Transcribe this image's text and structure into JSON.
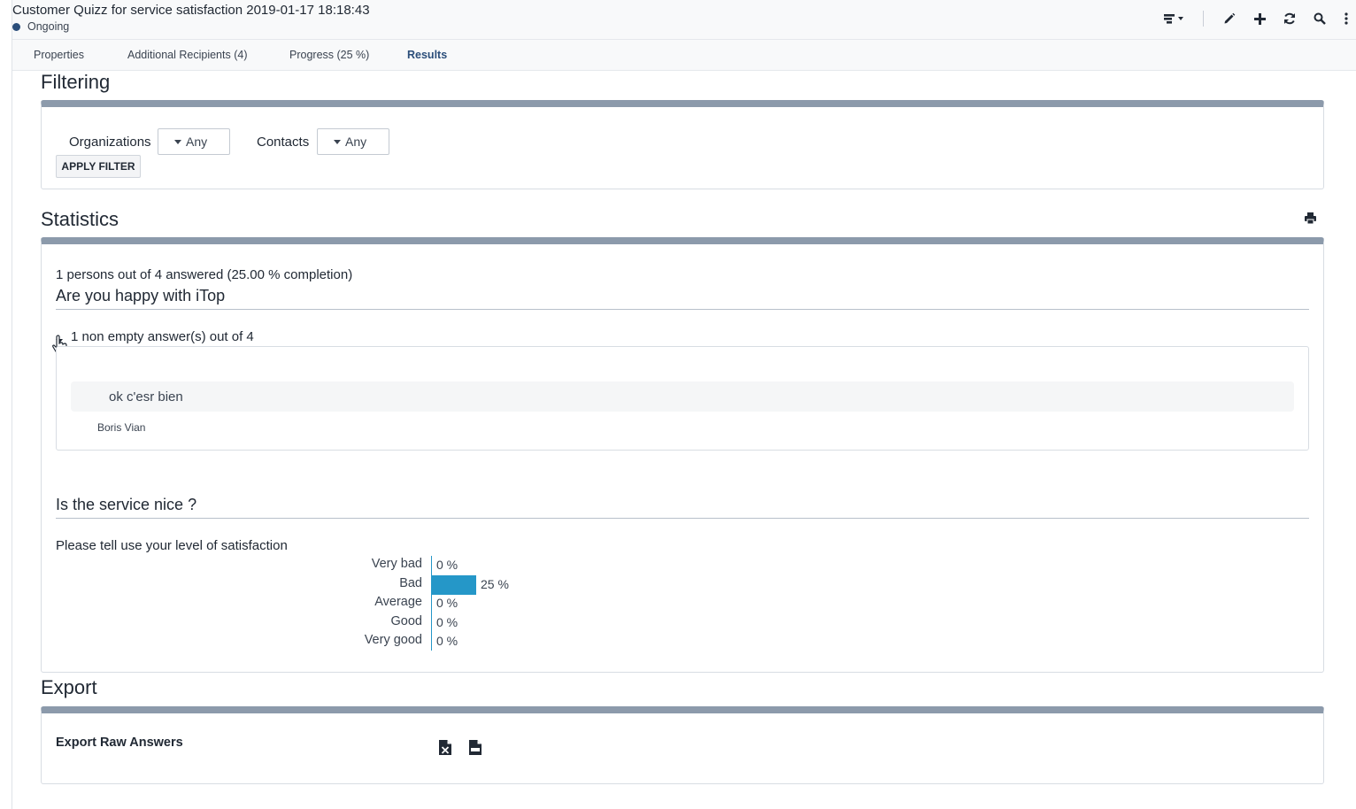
{
  "header": {
    "title": "Customer Quizz for service satisfaction 2019-01-17 18:18:43",
    "status": "Ongoing"
  },
  "toolbar": {
    "icons": [
      "actions-menu-icon",
      "edit-icon",
      "add-icon",
      "refresh-icon",
      "search-icon",
      "more-icon"
    ]
  },
  "tabs": [
    {
      "label": "Properties",
      "active": false
    },
    {
      "label": "Additional Recipients (4)",
      "active": false
    },
    {
      "label": "Progress (25 %)",
      "active": false
    },
    {
      "label": "Results",
      "active": true
    }
  ],
  "filtering": {
    "title": "Filtering",
    "organizations_label": "Organizations",
    "organizations_value": "Any",
    "contacts_label": "Contacts",
    "contacts_value": "Any",
    "apply_label": "APPLY FILTER"
  },
  "statistics": {
    "title": "Statistics",
    "summary": "1 persons out of 4 answered (25.00 % completion)",
    "q1": {
      "title": "Are you happy with iTop",
      "count_text": "1 non empty answer(s) out of 4",
      "answer": "ok c'esr bien",
      "author": "Boris Vian"
    },
    "q2": {
      "title": "Is the service nice ?",
      "prompt": "Please tell use your level of satisfaction",
      "levels": [
        {
          "label": "Very bad",
          "value": "0 %"
        },
        {
          "label": "Bad",
          "value": "25 %"
        },
        {
          "label": "Average",
          "value": "0 %"
        },
        {
          "label": "Good",
          "value": "0 %"
        },
        {
          "label": "Very good",
          "value": "0 %"
        }
      ]
    }
  },
  "chart_data": {
    "type": "bar",
    "categories": [
      "Very bad",
      "Bad",
      "Average",
      "Good",
      "Very good"
    ],
    "values": [
      0,
      25,
      0,
      0,
      0
    ],
    "unit": "%",
    "color": "#2597c8"
  },
  "export": {
    "title": "Export",
    "raw_label": "Export Raw Answers",
    "icons": [
      "xlsx-file-icon",
      "csv-file-icon"
    ]
  },
  "colors": {
    "accent": "#2b4e7a",
    "bar": "#2597c8",
    "panel_top": "#8c9aab"
  }
}
